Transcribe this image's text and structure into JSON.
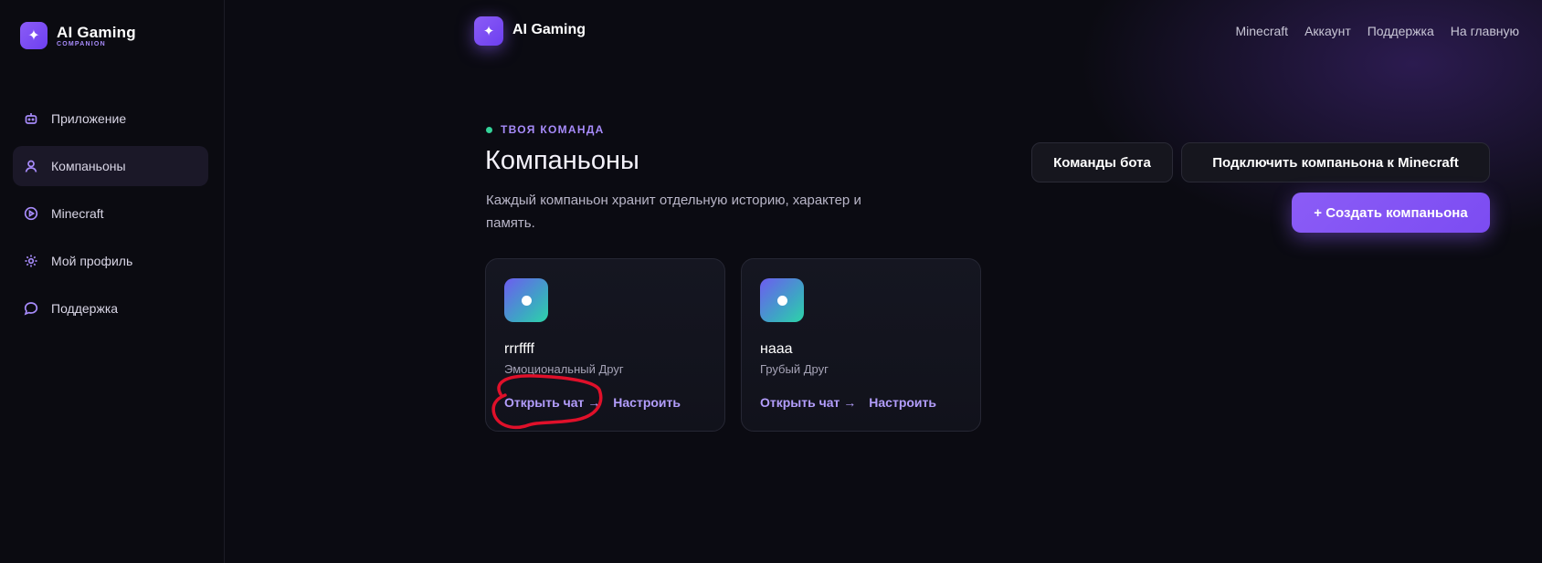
{
  "sidebar": {
    "brand": {
      "title": "AI Gaming",
      "subtitle": "COMPANION",
      "logo_icon": "sparkle-icon"
    },
    "items": [
      {
        "label": "Приложение",
        "icon": "bot-icon",
        "active": false
      },
      {
        "label": "Компаньоны",
        "icon": "user-icon",
        "active": true
      },
      {
        "label": "Minecraft",
        "icon": "play-circle-icon",
        "active": false
      },
      {
        "label": "Мой профиль",
        "icon": "gear-icon",
        "active": false
      },
      {
        "label": "Поддержка",
        "icon": "chat-bubble-icon",
        "active": false
      }
    ]
  },
  "topbar": {
    "title": "AI Gaming",
    "logo_icon": "sparkle-icon",
    "nav": [
      "Minecraft",
      "Аккаунт",
      "Поддержка",
      "На главную"
    ]
  },
  "header": {
    "eyebrow": "ТВОЯ КОМАНДА",
    "title": "Компаньоны",
    "description": "Каждый компаньон хранит отдельную историю, характер и память."
  },
  "actions": {
    "commands_label": "Команды бота",
    "connect_label": "Подключить компаньона к Minecraft",
    "create_label": "+ Создать компаньона"
  },
  "companions": [
    {
      "name": "rrrffff",
      "role": "Эмоциональный Друг",
      "open_chat": "Открыть чат →",
      "configure": "Настроить"
    },
    {
      "name": "наaa",
      "role": "Грубый Друг",
      "open_chat": "Открыть чат →",
      "configure": "Настроить"
    }
  ],
  "colors": {
    "accent": "#8b5cf6",
    "accent_text": "#a78bfa",
    "status_dot": "#34d399",
    "annotation": "#e0102a"
  }
}
